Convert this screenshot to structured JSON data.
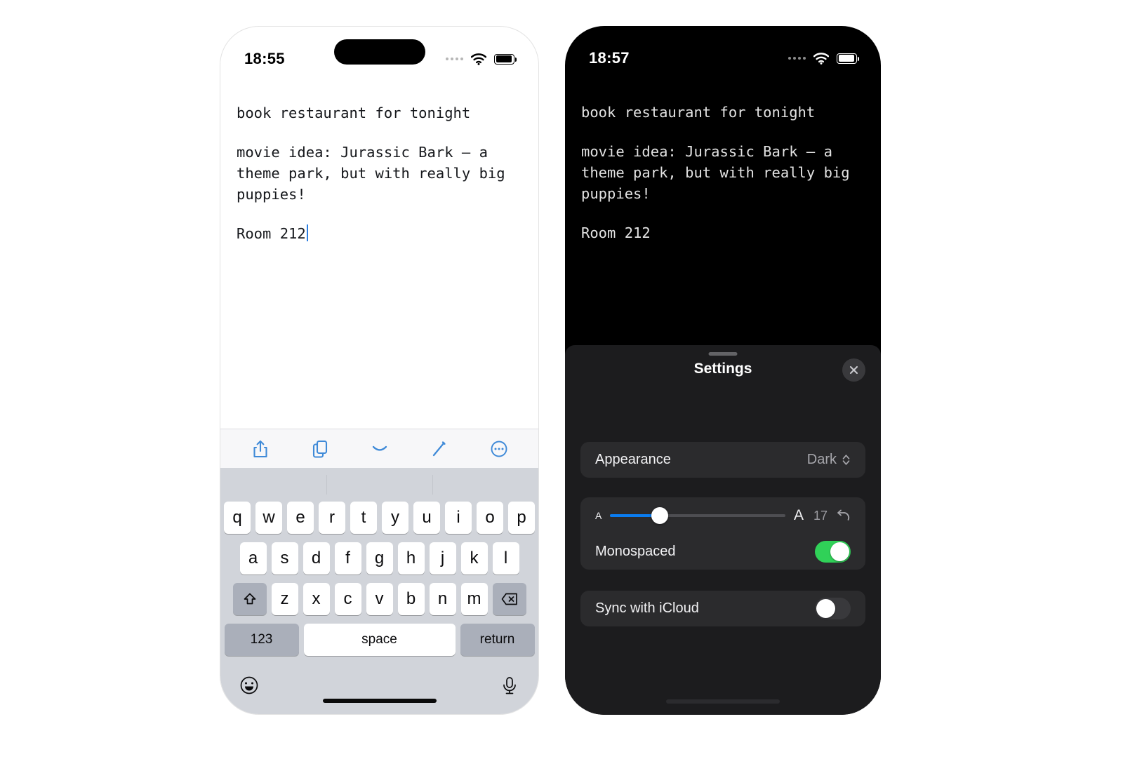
{
  "left_phone": {
    "status": {
      "time": "18:55",
      "signal_icon": "signal-dots-icon",
      "wifi_icon": "wifi-icon",
      "battery_icon": "battery-icon"
    },
    "note": {
      "line1": "book restaurant for tonight",
      "line2": "movie idea: Jurassic Bark — a theme park, but with really big puppies!",
      "line3": "Room 212"
    },
    "toolbar": {
      "share_label": "share-icon",
      "copy_label": "documents-icon",
      "dismiss_label": "chevron-down-icon",
      "edit_label": "pencil-icon",
      "more_label": "ellipsis-circle-icon"
    },
    "keyboard": {
      "row1": [
        "q",
        "w",
        "e",
        "r",
        "t",
        "y",
        "u",
        "i",
        "o",
        "p"
      ],
      "row2": [
        "a",
        "s",
        "d",
        "f",
        "g",
        "h",
        "j",
        "k",
        "l"
      ],
      "row3": [
        "z",
        "x",
        "c",
        "v",
        "b",
        "n",
        "m"
      ],
      "shift_label": "shift-icon",
      "backspace_label": "backspace-icon",
      "numeric_label": "123",
      "space_label": "space",
      "return_label": "return",
      "emoji_label": "emoji-icon",
      "dictation_label": "microphone-icon"
    }
  },
  "right_phone": {
    "status": {
      "time": "18:57",
      "signal_icon": "signal-dots-icon",
      "wifi_icon": "wifi-icon",
      "battery_icon": "battery-icon"
    },
    "note": {
      "line1": "book restaurant for tonight",
      "line2": "movie idea: Jurassic Bark — a theme park, but with really big puppies!",
      "line3": "Room 212"
    },
    "settings": {
      "title": "Settings",
      "close_label": "close-icon",
      "appearance": {
        "label": "Appearance",
        "value": "Dark",
        "chevron": "chevron-updown-icon"
      },
      "font_size": {
        "small_label": "A",
        "large_label": "A",
        "value": "17",
        "reset_label": "reset-arrow-icon",
        "slider_percent": 28.5
      },
      "monospaced": {
        "label": "Monospaced",
        "enabled": "on"
      },
      "sync_icloud": {
        "label": "Sync with iCloud",
        "enabled": "off"
      }
    }
  },
  "colors": {
    "accent_blue": "#3f8ad8",
    "slider_blue": "#0a7cf0",
    "toggle_green": "#30d158",
    "caret_blue": "#2b7de0"
  }
}
